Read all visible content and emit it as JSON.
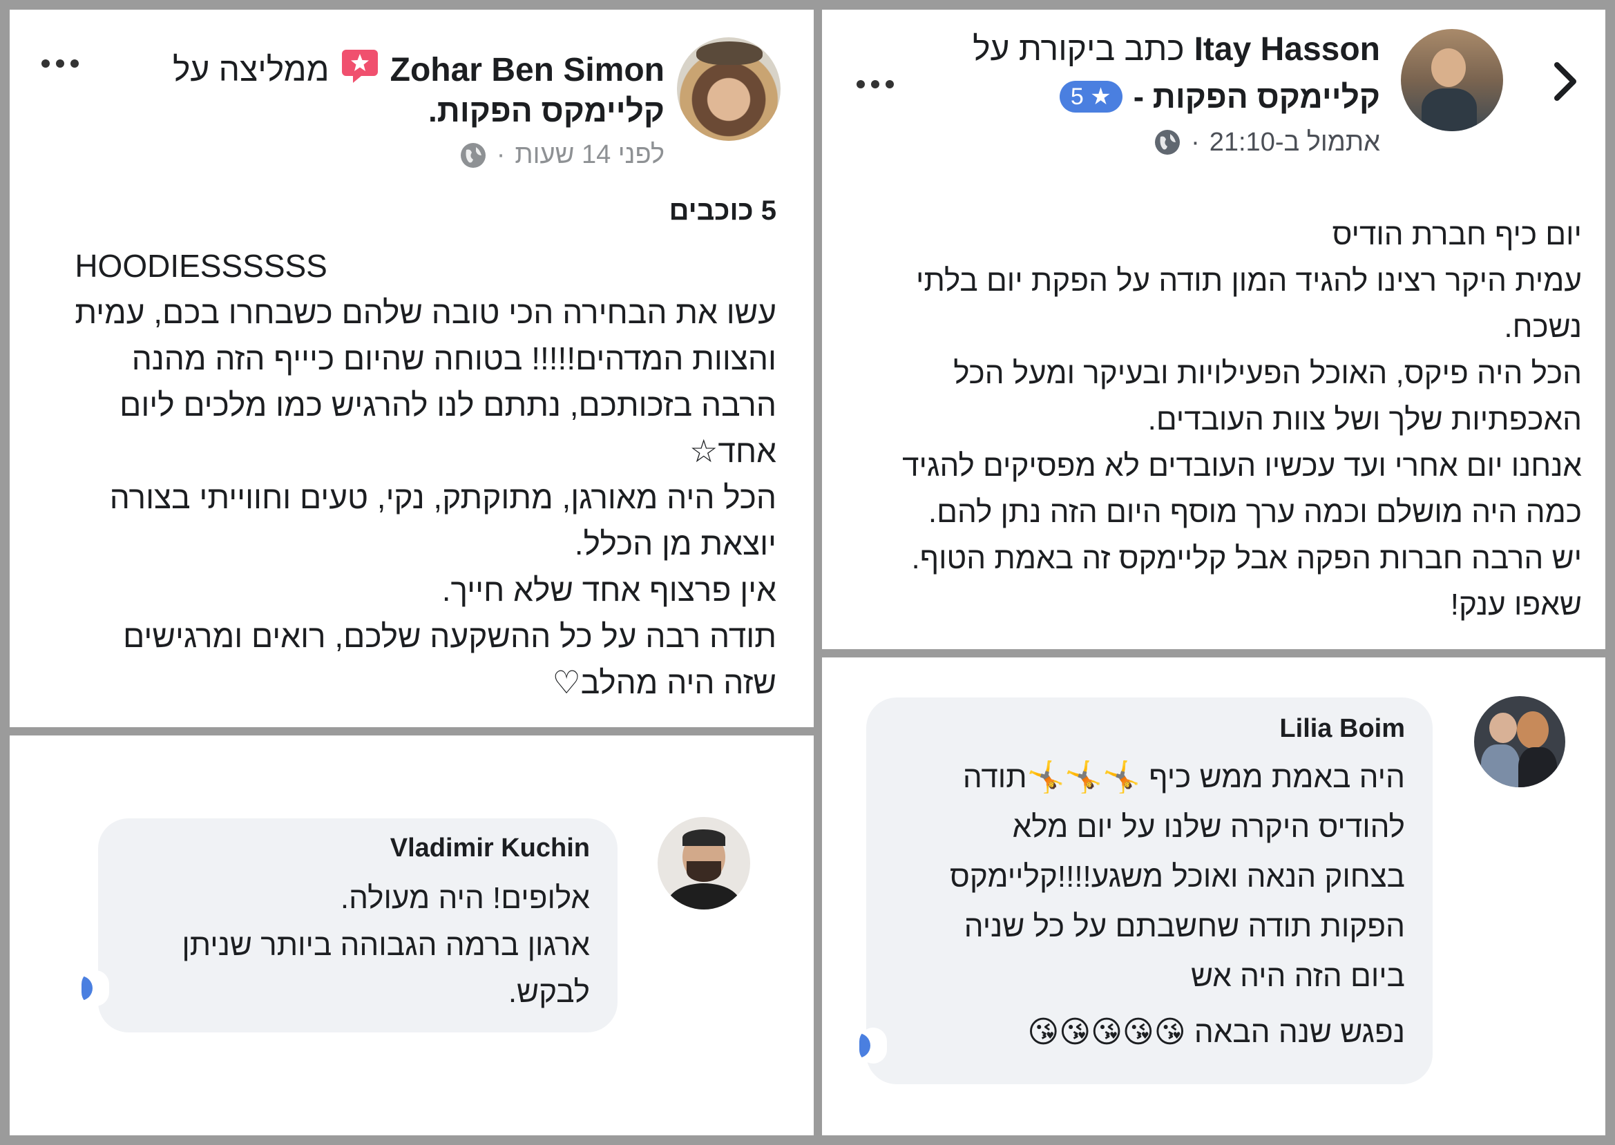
{
  "post_zohar": {
    "author": "Zohar Ben Simon",
    "action": "ממליצה על",
    "page": "קליימקס הפקות.",
    "time": "לפני 14 שעות",
    "rating": "5 כוכבים",
    "lines": [
      "HOODIESSSSSS",
      "עשו את הבחירה הכי טובה שלהם כשבחרו בכם, עמית",
      "והצוות המדהים!!!!! בטוחה שהיום כיייף הזה מהנה",
      "הרבה בזכותכם, נתתם לנו להרגיש כמו מלכים ליום",
      "אחד☆",
      "הכל היה מאורגן, מתוקתק, נקי, טעים וחווייתי בצורה",
      "יוצאת מן הכלל.",
      "אין פרצוף אחד שלא חייך.",
      "תודה רבה על כל ההשקעה שלכם, רואים ומרגישים",
      "שזה היה מהלב♡"
    ]
  },
  "post_itay": {
    "author": "Itay Hasson",
    "action": "כתב ביקורת על",
    "page": "קליימקס הפקות -",
    "rating_badge": "5 ★",
    "time": "אתמול ב-21:10",
    "lines": [
      "יום כיף חברת הודיס",
      "עמית היקר רצינו להגיד המון תודה על הפקת יום בלתי",
      "נשכח.",
      "הכל היה פיקס, האוכל הפעילויות ובעיקר ומעל הכל",
      "האכפתיות שלך ושל צוות העובדים.",
      "אנחנו יום אחרי ועד עכשיו העובדים לא מפסיקים להגיד",
      "כמה היה מושלם וכמה ערך מוסף היום הזה נתן להם.",
      "יש הרבה חברות הפקה אבל קליימקס זה באמת הטוף.",
      "שאפו ענק!"
    ]
  },
  "comment_vladimir": {
    "author": "Vladimir Kuchin",
    "lines": [
      "אלופים! היה מעולה.",
      "ארגון ברמה הגבוהה ביותר שניתן",
      "לבקש."
    ]
  },
  "comment_lilia": {
    "author": "Lilia Boim",
    "lines": [
      "היה באמת ממש כיף 🤸🤸🤸תודה",
      "להודיס היקרה שלנו על יום מלא",
      "בצחוק הנאה ואוכל משגע!!!!קליימקס",
      "הפקות תודה שחשבתם על כל שניה",
      "ביום הזה היה אש",
      "נפגש שנה הבאה 😘😘😘😘😘"
    ]
  },
  "colors": {
    "frame": "#9b9b9b",
    "bubble": "#f0f2f5",
    "badge_blue": "#4a7fe0",
    "recommend_red": "#f0506e"
  },
  "icons": [
    "more-icon",
    "recommend-icon",
    "globe-icon",
    "chevron-right-icon",
    "star-icon"
  ]
}
